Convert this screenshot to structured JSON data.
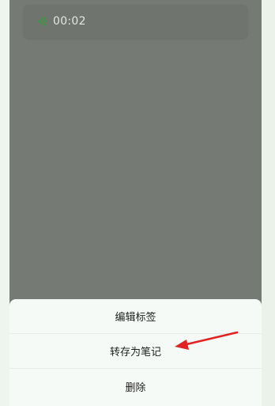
{
  "voice_note": {
    "duration": "00:02",
    "icon": "voice-wave-icon",
    "icon_color": "#3c9a3c"
  },
  "action_sheet": {
    "items": [
      {
        "label": "编辑标签"
      },
      {
        "label": "转存为笔记"
      },
      {
        "label": "删除"
      }
    ]
  },
  "annotation": {
    "icon": "red-arrow-icon",
    "color": "#e02424"
  }
}
